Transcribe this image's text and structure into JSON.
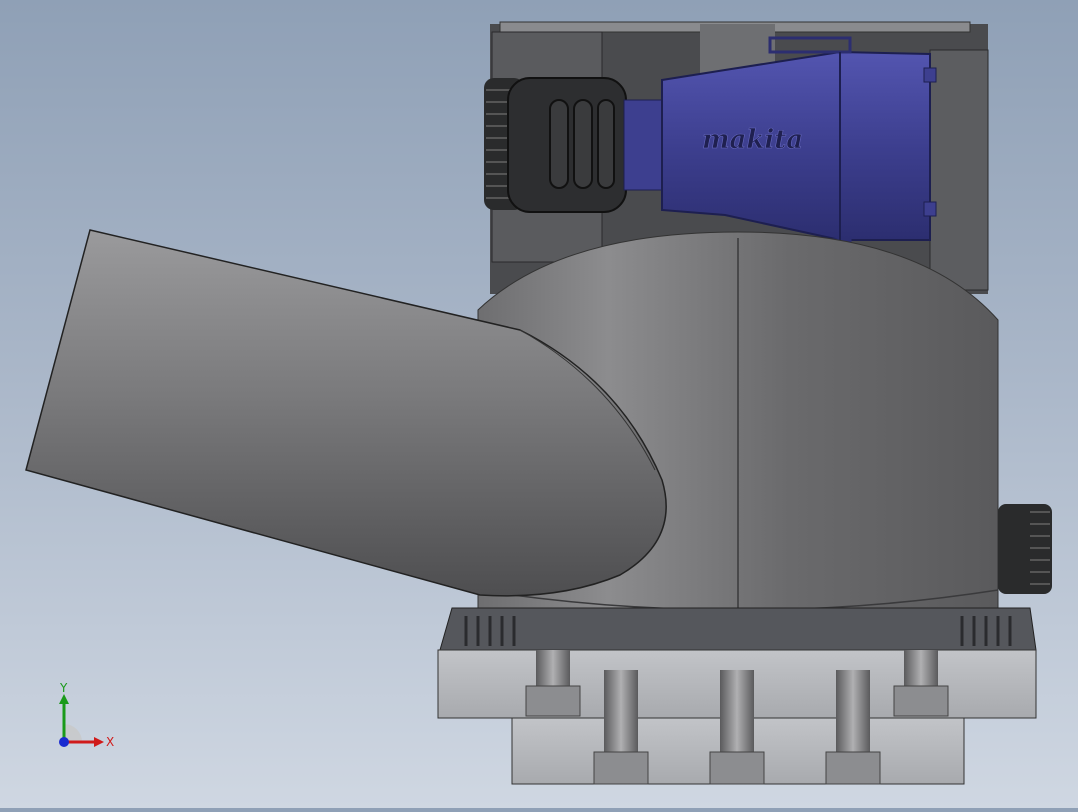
{
  "viewport": {
    "brand_logo_text": "makita",
    "colors": {
      "background_top": "#8fa0b6",
      "background_bottom": "#cfd7e2",
      "body_gray": "#7c7c7e",
      "dark_gray": "#4c4d50",
      "motor_blue": "#3d3f8f",
      "knob_black": "#222324",
      "base_plate": "#b6b8bc"
    }
  },
  "triad": {
    "x_label": "X",
    "y_label": "Y",
    "colors": {
      "x": "#d01a1a",
      "y": "#1a9a1a",
      "z": "#1a2ad0"
    }
  }
}
